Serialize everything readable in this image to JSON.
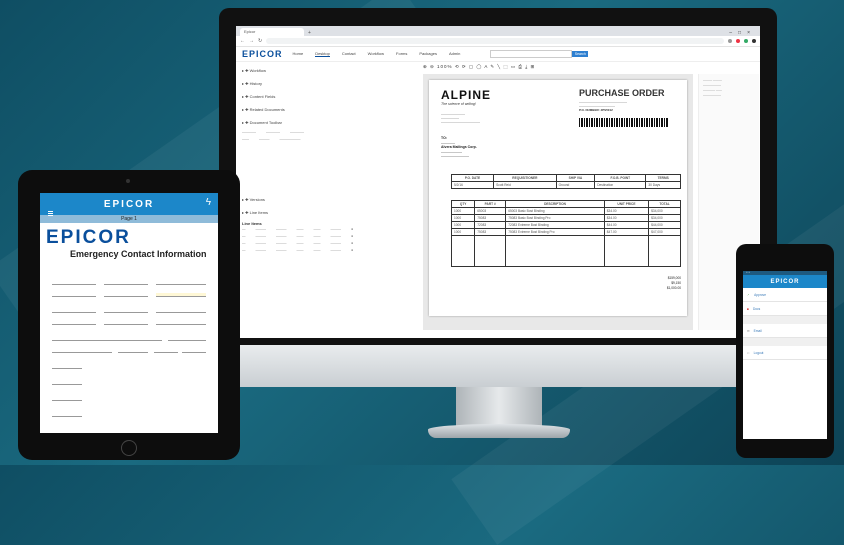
{
  "monitor": {
    "browser_tab": "Epicor",
    "app_logo": "EPICOR",
    "menu": [
      "Home",
      "Desktop",
      "Contact",
      "Workflow",
      "Forms",
      "Packages",
      "Admin"
    ],
    "search_button": "Search",
    "tree_items": [
      "Workflow",
      "History",
      "Content Fields",
      "Related Documents",
      "Document Toolbar",
      "Versions",
      "Line Items"
    ],
    "line_items_label": "Line Items",
    "doc_toolbar_zoom": "100%",
    "document": {
      "vendor_logo": "ALPINE",
      "tagline": "The science of writing!",
      "title": "PURCHASE ORDER",
      "po_number_label": "P.O. NUMBER: 4PS5012",
      "to_label": "TO:",
      "to_company": "Alvera Mailings Corp.",
      "header_columns": [
        "P.O. DATE",
        "REQUISITIONER",
        "SHIP VIA",
        "F.O.B. POINT",
        "TERMS"
      ],
      "header_values": [
        "5/2/16",
        "Scott Reid",
        "Ground",
        "Destination",
        "30 Days"
      ],
      "line_columns": [
        "QTY",
        "PART #",
        "DESCRIPTION",
        "UNIT PRICE",
        "TOTAL"
      ],
      "lines": [
        [
          "1000",
          "65003",
          "65003 Basic Bost Binding",
          "$34.00",
          "$34,000"
        ],
        [
          "1000",
          "75083",
          "75083 Basic Bost Binding Pro",
          "$34.00",
          "$34,000"
        ],
        [
          "1000",
          "72083",
          "72083 Extreme Bost Binding",
          "$44.00",
          "$44,000"
        ],
        [
          "1000",
          "75083",
          "75083 Extreme Bost Binding Pro",
          "$47.00",
          "$47,000"
        ]
      ],
      "subtotal": "$159,000",
      "tax": "$9,150",
      "shipping": "$1,000.00"
    }
  },
  "tablet": {
    "header_title": "EPICOR",
    "page_label": "Page 1",
    "logo": "EPICOR",
    "form_title": "Emergency Contact Information"
  },
  "phone": {
    "header_title": "EPICOR",
    "menu_items": [
      "Approve",
      "Docs",
      "Email",
      "Logout"
    ]
  },
  "colors": {
    "background": "#0f4e63",
    "epicor_blue": "#0a4f9c",
    "header_blue": "#1c87c9"
  }
}
